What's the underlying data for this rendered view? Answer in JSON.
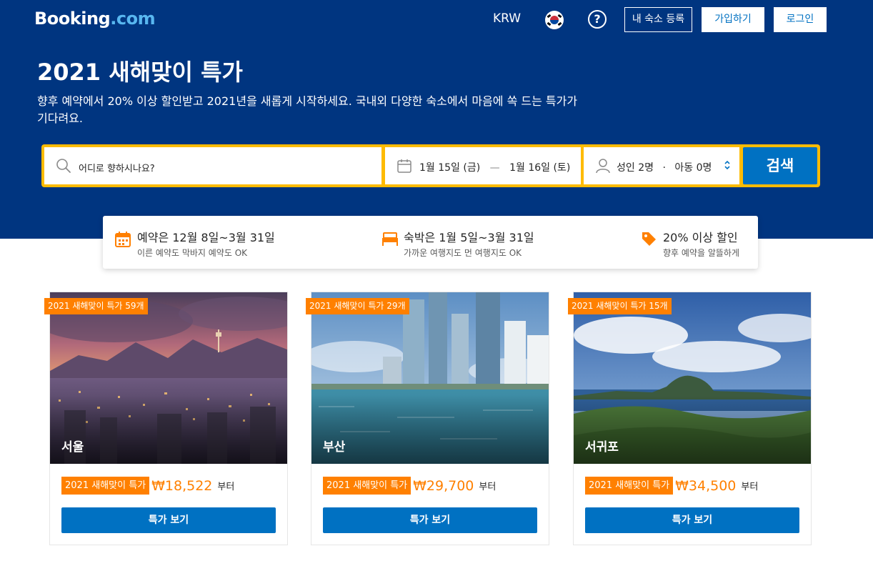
{
  "header": {
    "logo_main": "Booking",
    "logo_suffix": ".com",
    "currency": "KRW",
    "help_icon": "?",
    "list_property_label": "내 숙소 등록",
    "register_label": "가입하기",
    "login_label": "로그인"
  },
  "hero": {
    "title": "2021 새해맞이 특가",
    "subtitle": "향후 예약에서 20% 이상 할인받고 2021년을 새롭게 시작하세요. 국내외 다양한 숙소에서 마음에 쏙 드는 특가가 기다려요."
  },
  "search": {
    "destination_placeholder": "어디로 향하시나요?",
    "checkin": "1월 15일 (금)",
    "date_separator": "—",
    "checkout": "1월 16일 (토)",
    "adults": "성인 2명",
    "guest_separator": "·",
    "children": "아동 0명",
    "search_label": "검색"
  },
  "perks": [
    {
      "icon": "calendar-icon",
      "title": "예약은 12월 8일~3월 31일",
      "subtitle": "이른 예약도 막바지 예약도 OK"
    },
    {
      "icon": "bed-icon",
      "title": "숙박은 1월 5일~3월 31일",
      "subtitle": "가까운 여행지도 먼 여행지도 OK"
    },
    {
      "icon": "price-tag-icon",
      "title": "20% 이상 할인",
      "subtitle": "향후 예약을 알뜰하게"
    }
  ],
  "cards": [
    {
      "badge": "2021 새해맞이 특가 59개",
      "city": "서울",
      "tag": "2021 새해맞이 특가",
      "price": "₩18,522",
      "from": "부터",
      "button": "특가 보기"
    },
    {
      "badge": "2021 새해맞이 특가 29개",
      "city": "부산",
      "tag": "2021 새해맞이 특가",
      "price": "₩29,700",
      "from": "부터",
      "button": "특가 보기"
    },
    {
      "badge": "2021 새해맞이 특가 15개",
      "city": "서귀포",
      "tag": "2021 새해맞이 특가",
      "price": "₩34,500",
      "from": "부터",
      "button": "특가 보기"
    }
  ],
  "colors": {
    "brand_blue": "#003580",
    "action_blue": "#0071c2",
    "search_border": "#febb02",
    "deal_orange": "#ff8000"
  }
}
